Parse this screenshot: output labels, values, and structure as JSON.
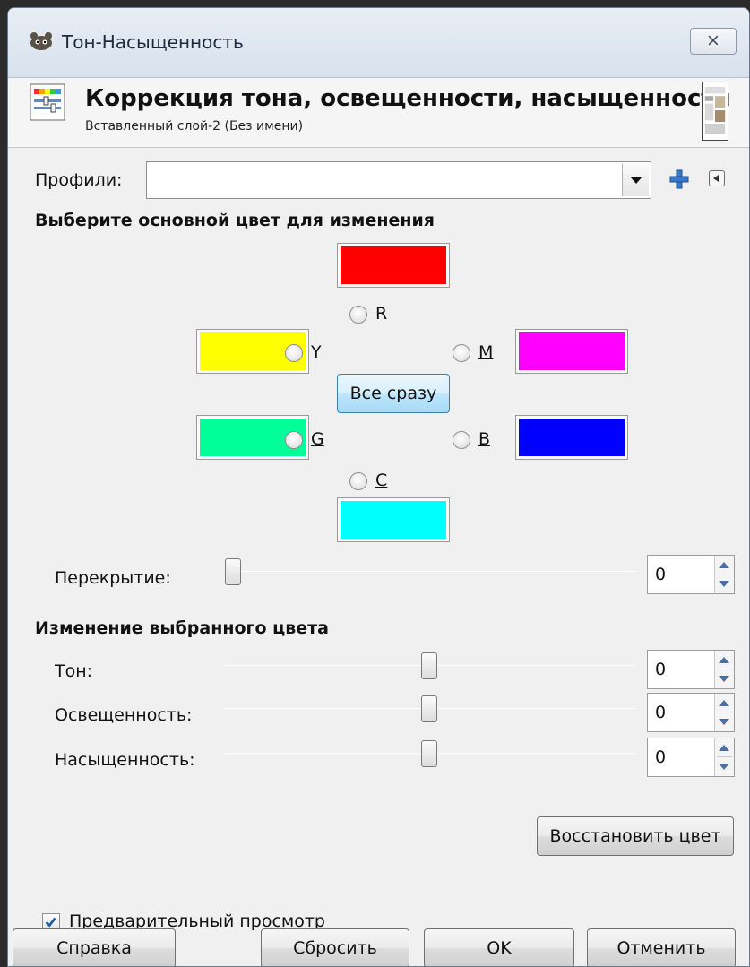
{
  "window": {
    "title": "Тон-Насыщенность",
    "close_label": "⨯"
  },
  "header": {
    "title": "Коррекция тона, освещенности, насыщенности",
    "subtitle": "Вставленный слой-2 (Без имени)"
  },
  "profiles": {
    "label": "Профили:",
    "value": ""
  },
  "primary_color": {
    "heading": "Выберите основной цвет для изменения",
    "options": [
      {
        "key": "R",
        "label": "R",
        "color": "#ff0000"
      },
      {
        "key": "Y",
        "label": "Y",
        "color": "#ffff00"
      },
      {
        "key": "M",
        "label": "M",
        "color": "#ff00ff"
      },
      {
        "key": "G",
        "label": "G",
        "color": "#00ff99"
      },
      {
        "key": "B",
        "label": "B",
        "color": "#0000ff"
      },
      {
        "key": "C",
        "label": "C",
        "color": "#00ffff"
      }
    ],
    "all_button": "Все сразу",
    "overlap_label": "Перекрытие:",
    "overlap_value": "0"
  },
  "adjust": {
    "heading": "Изменение выбранного цвета",
    "hue_label": "Тон:",
    "hue_value": "0",
    "lightness_label": "Освещенность:",
    "lightness_value": "0",
    "saturation_label": "Насыщенность:",
    "saturation_value": "0",
    "reset_color_button": "Восстановить цвет"
  },
  "preview": {
    "label": "Предварительный просмотр",
    "checked": true
  },
  "buttons": {
    "help": "Справка",
    "reset": "Сбросить",
    "ok": "OK",
    "cancel": "Отменить"
  }
}
